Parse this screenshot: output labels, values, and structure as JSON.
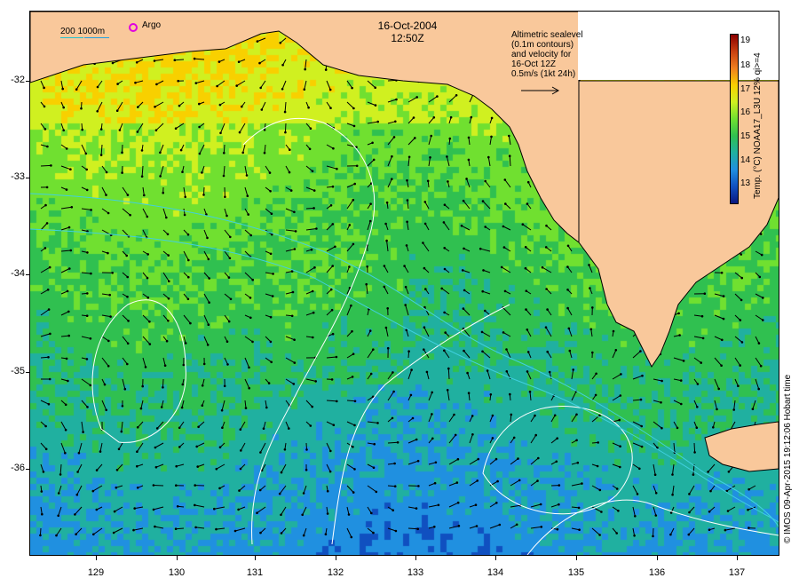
{
  "title": {
    "date": "16-Oct-2004",
    "time": "12:50Z"
  },
  "scale_label": "200  1000m",
  "argo_label": "Argo",
  "legend": {
    "lines": [
      "Altimetric sealevel",
      "(0.1m contours)",
      "and velocity for",
      "16-Oct 12Z",
      "0.5m/s (1kt 24h)"
    ]
  },
  "colorbar": {
    "title": "Temp. (°C) NOAA17_L3U 12% qi>=4",
    "ticks": [
      "19",
      "18",
      "17",
      "16",
      "15",
      "14",
      "13"
    ],
    "colors": [
      "#8b0000",
      "#c84010",
      "#f08020",
      "#f8d000",
      "#d0f020",
      "#70e030",
      "#30c050",
      "#20b0a0",
      "#2090e0",
      "#1050c0",
      "#0a1880"
    ]
  },
  "axes": {
    "x_ticks": [
      "129",
      "130",
      "131",
      "132",
      "133",
      "134",
      "135",
      "136",
      "137"
    ],
    "y_ticks": [
      "-32",
      "-33",
      "-34",
      "-35",
      "-36"
    ]
  },
  "credit": "© IMOS 09-Apr-2015 19:12:06 Hobart time",
  "colors": {
    "land": "#f9c89b",
    "contour": "#ffffff",
    "bathymetry": "#40d0e0"
  }
}
